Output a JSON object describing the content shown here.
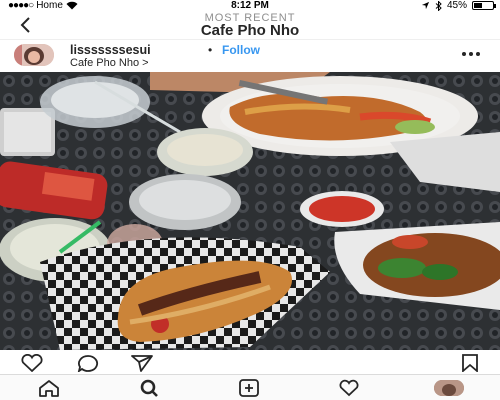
{
  "status_bar": {
    "carrier": "Home",
    "time": "8:12 PM",
    "battery": "45%",
    "battery_level": 0.45,
    "icons": [
      "signal-dots-icon",
      "wifi-icon",
      "location-icon",
      "bluetooth-icon",
      "battery-icon"
    ]
  },
  "header": {
    "subtitle": "MOST RECENT",
    "title": "Cafe Pho Nho",
    "back_icon": "back-chevron-icon"
  },
  "post": {
    "username": "lisssssssesui",
    "separator": "•",
    "follow_label": "Follow",
    "location": "Cafe Pho Nho >",
    "more_icon": "more-dots-icon",
    "photo_alt": "photo"
  },
  "actions": {
    "icons": [
      "heart-icon",
      "comment-icon",
      "share-icon",
      "bookmark-icon"
    ]
  },
  "tabbar": {
    "icons": [
      "home-icon",
      "search-icon",
      "add-post-icon",
      "activity-heart-icon",
      "profile-avatar"
    ]
  },
  "colors": {
    "link": "#3897f0",
    "text": "#262626",
    "muted": "#8e8e8e"
  }
}
